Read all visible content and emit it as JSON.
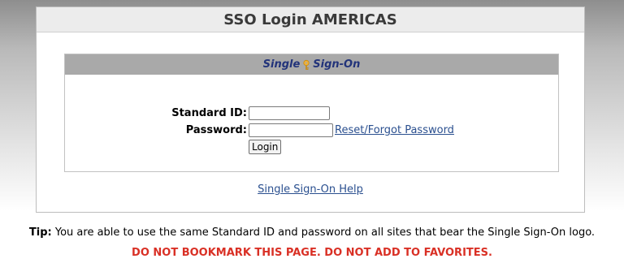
{
  "page": {
    "title": "SSO Login AMERICAS",
    "panel_title_part1": "Single",
    "panel_title_part2": "Sign-On",
    "standard_id_label": "Standard ID:",
    "password_label": "Password:",
    "standard_id_value": "",
    "password_value": "",
    "reset_link": "Reset/Forgot Password",
    "login_button": "Login",
    "help_link": "Single Sign-On Help",
    "tip_label": "Tip:",
    "tip_text": " You are able to use the same Standard ID and password on all sites that bear the Single Sign-On logo.",
    "warning": "DO NOT BOOKMARK THIS PAGE. DO NOT ADD TO FAVORITES."
  },
  "icons": {
    "logo_key": "key-icon"
  },
  "colors": {
    "warning": "#d93025",
    "link": "#2a4f8f",
    "panel_title": "#22337a"
  }
}
